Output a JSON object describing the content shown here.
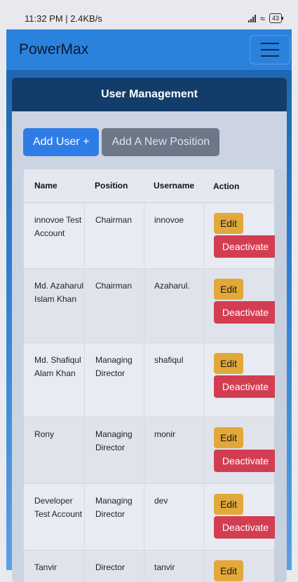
{
  "status_bar": {
    "time_speed": "11:32 PM | 2.4KB/s",
    "battery": "43"
  },
  "navbar": {
    "brand": "PowerMax"
  },
  "card": {
    "title": "User Management",
    "add_user_label": "Add User +",
    "add_position_label": "Add A New Position"
  },
  "table": {
    "headers": [
      "Name",
      "Position",
      "Username",
      "Action"
    ],
    "edit_label": "Edit",
    "deactivate_label": "Deactivate",
    "rows": [
      {
        "name": "innovoe Test Account",
        "position": "Chairman",
        "username": "innovoe"
      },
      {
        "name": "Md. Azaharul Islam Khan",
        "position": "Chairman",
        "username": "Azaharul."
      },
      {
        "name": "Md. Shafiqul Alam Khan",
        "position": "Managing Director",
        "username": "shafiqul"
      },
      {
        "name": "Rony",
        "position": "Managing Director",
        "username": "monir"
      },
      {
        "name": "Developer Test Account",
        "position": "Managing Director",
        "username": "dev"
      },
      {
        "name": "Tanvir",
        "position": "Director",
        "username": "tanvir"
      }
    ]
  },
  "colors": {
    "navbar": "#2b82dc",
    "card_header": "#123d6b",
    "primary": "#2e7de6",
    "secondary": "#6c7787",
    "warning": "#e2a93a",
    "danger": "#d33d51"
  }
}
